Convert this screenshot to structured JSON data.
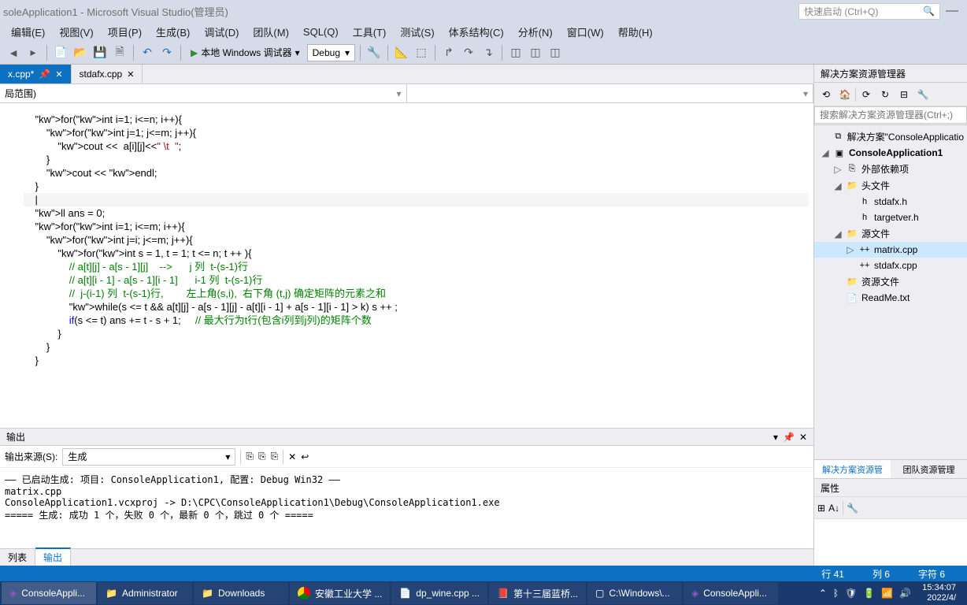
{
  "titlebar": {
    "title": "soleApplication1 - Microsoft Visual Studio(管理员)",
    "quickstart": "快速启动 (Ctrl+Q)"
  },
  "menu": [
    "编辑(E)",
    "视图(V)",
    "项目(P)",
    "生成(B)",
    "调试(D)",
    "团队(M)",
    "SQL(Q)",
    "工具(T)",
    "测试(S)",
    "体系结构(C)",
    "分析(N)",
    "窗口(W)",
    "帮助(H)"
  ],
  "toolbar": {
    "debugger": "本地 Windows 调试器",
    "config": "Debug"
  },
  "doctabs": [
    {
      "label": "x.cpp*",
      "active": true,
      "pinned": true
    },
    {
      "label": "stdafx.cpp",
      "active": false
    }
  ],
  "nav_scope": "局范围)",
  "code_lines": [
    {
      "t": "    for(int i=1; i<=n; i++){"
    },
    {
      "t": "        for(int j=1; j<=m; j++){"
    },
    {
      "t": "            cout <<  a[i][j]<<\" \\t  \";"
    },
    {
      "t": "        }"
    },
    {
      "t": "        cout << endl;"
    },
    {
      "t": "    }"
    },
    {
      "t": ""
    },
    {
      "t": ""
    },
    {
      "t": "    |",
      "cl": true
    },
    {
      "t": "    ll ans = 0;"
    },
    {
      "t": "    for(int i=1; i<=m; i++){"
    },
    {
      "t": "        for(int j=i; j<=m; j++){"
    },
    {
      "t": "            for(int s = 1, t = 1; t <= n; t ++ ){"
    },
    {
      "t": "                // a[t][j] - a[s - 1][j]    -->      j 列  t-(s-1)行",
      "c": "cmt"
    },
    {
      "t": "                // a[t][i - 1] - a[s - 1][i - 1]      i-1 列  t-(s-1)行",
      "c": "cmt"
    },
    {
      "t": "                //  j-(i-1) 列  t-(s-1)行,        左上角(s,i),  右下角 (t,j) 确定矩阵的元素之和",
      "c": "cmt"
    },
    {
      "t": "                while(s <= t && a[t][j] - a[s - 1][j] - a[t][i - 1] + a[s - 1][i - 1] > k) s ++ ;"
    },
    {
      "t": "                if(s <= t) ans += t - s + 1;     // 最大行为t行(包含i列到j列)的矩阵个数",
      "p": "                if(s <= t) ans += t - s + 1;     ",
      "cm": "// 最大行为t行(包含i列到j列)的矩阵个数"
    },
    {
      "t": "            }"
    },
    {
      "t": "        }"
    },
    {
      "t": "    }"
    }
  ],
  "output": {
    "title": "输出",
    "source_label": "输出来源(S):",
    "source": "生成",
    "text": "—— 已启动生成: 项目: ConsoleApplication1, 配置: Debug Win32 ——\nmatrix.cpp\nConsoleApplication1.vcxproj -> D:\\CPC\\ConsoleApplication1\\Debug\\ConsoleApplication1.exe\n===== 生成: 成功 1 个，失败 0 个，最新 0 个，跳过 0 个 =====",
    "tabs": [
      "列表",
      "输出"
    ],
    "active_tab": 1
  },
  "solution": {
    "title": "解决方案资源管理器",
    "search_placeholder": "搜索解决方案资源管理器(Ctrl+;)",
    "tree": [
      {
        "lvl": 0,
        "exp": "",
        "icon": "⧉",
        "label": "解决方案\"ConsoleApplicatio"
      },
      {
        "lvl": 0,
        "exp": "◢",
        "icon": "▣",
        "label": "ConsoleApplication1",
        "bold": true
      },
      {
        "lvl": 1,
        "exp": "▷",
        "icon": "⎘",
        "label": "外部依赖项"
      },
      {
        "lvl": 1,
        "exp": "◢",
        "icon": "📁",
        "label": "头文件"
      },
      {
        "lvl": 2,
        "exp": "",
        "icon": "h",
        "label": "stdafx.h"
      },
      {
        "lvl": 2,
        "exp": "",
        "icon": "h",
        "label": "targetver.h"
      },
      {
        "lvl": 1,
        "exp": "◢",
        "icon": "📁",
        "label": "源文件"
      },
      {
        "lvl": 2,
        "exp": "▷",
        "icon": "++",
        "label": "matrix.cpp",
        "selected": true
      },
      {
        "lvl": 2,
        "exp": "",
        "icon": "++",
        "label": "stdafx.cpp"
      },
      {
        "lvl": 1,
        "exp": "",
        "icon": "📁",
        "label": "资源文件"
      },
      {
        "lvl": 1,
        "exp": "",
        "icon": "📄",
        "label": "ReadMe.txt"
      }
    ],
    "panel_tabs": [
      "解决方案资源管理...",
      "团队资源管理"
    ],
    "props_title": "属性"
  },
  "statusbar": {
    "row": "行 41",
    "col": "列 6",
    "char": "字符 6"
  },
  "taskbar": {
    "items": [
      {
        "icon": "vs",
        "label": "ConsoleAppli...",
        "active": true
      },
      {
        "icon": "folder",
        "label": "Administrator"
      },
      {
        "icon": "folder",
        "label": "Downloads"
      },
      {
        "icon": "chrome",
        "label": "安徽工业大学 ..."
      },
      {
        "icon": "file",
        "label": "dp_wine.cpp ..."
      },
      {
        "icon": "pdf",
        "label": "第十三届蓝桥..."
      },
      {
        "icon": "cmd",
        "label": "C:\\Windows\\..."
      },
      {
        "icon": "vs",
        "label": "ConsoleAppli..."
      }
    ],
    "time": "15:34:07",
    "date": "2022/4/"
  }
}
